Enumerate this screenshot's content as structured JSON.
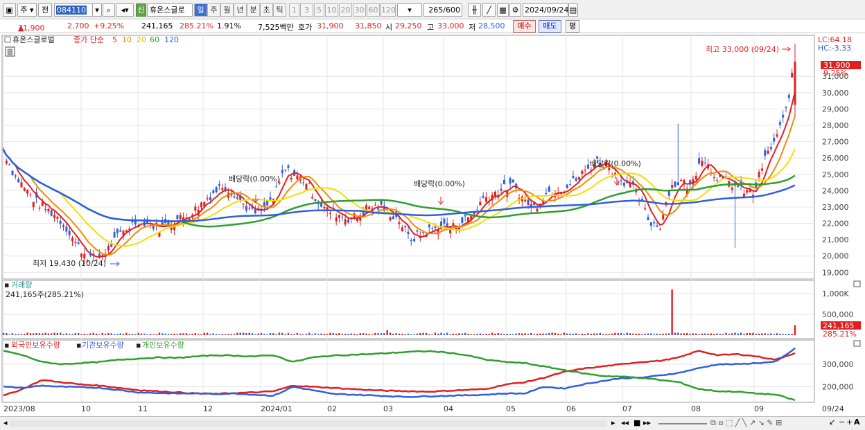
{
  "toolbar": {
    "type_label": "주",
    "prev_label": "전",
    "code": "084110",
    "new_badge": "신",
    "stock_name": "휴온스글로",
    "periods": [
      "일",
      "주",
      "월",
      "년",
      "분",
      "초",
      "틱"
    ],
    "active_period": "일",
    "intervals": [
      "1",
      "3",
      "5",
      "10",
      "20",
      "30",
      "60",
      "120"
    ],
    "count_display": "265",
    "count_max": "/600",
    "date": "2024/09/24"
  },
  "quote": {
    "price": "31,900",
    "change": "2,700",
    "change_pct": "+9.25%",
    "volume": "241,165",
    "vol_ratio": "285.21%",
    "turnover_pct": "1.91%",
    "amount": "7,525백만",
    "quote_label": "호가",
    "ask": "31,900",
    "bid": "31,850",
    "open_label": "시",
    "open": "29,250",
    "high_label": "고",
    "high": "33,000",
    "low_label": "저",
    "low": "28,500",
    "buy_label": "매수",
    "sell_label": "매도",
    "eval_label": "평"
  },
  "price_panel": {
    "legend_name": "휴온스글로벌",
    "legend_close": "종가 단순",
    "ma_labels": [
      "5",
      "10",
      "20",
      "60",
      "120"
    ],
    "ma_colors": [
      "#e02020",
      "#f08c00",
      "#f0e000",
      "#2e9e2e",
      "#2f5fe0"
    ],
    "lc": "LC:64.18",
    "hc": "HC:-3.33",
    "high_note": "최고 33,000 (09/24)",
    "low_note": "최저 19,430 (10/24)",
    "dividend_label": "배당락(0.00%)",
    "current_tag": "31,900",
    "current_pct": "9.25%",
    "y_ticks": [
      "31,000",
      "30,000",
      "29,000",
      "28,000",
      "27,000",
      "26,000",
      "25,000",
      "24,000",
      "23,000",
      "22,000",
      "21,000",
      "20,000",
      "19,000"
    ]
  },
  "volume_panel": {
    "title": "거래량",
    "value": "241,165주(285.21%)",
    "y_ticks": [
      "1,000K",
      "500,000"
    ],
    "current_tag": "241,165",
    "current_pct": "285.21%"
  },
  "holdings_panel": {
    "legend": [
      "외국인보유수량",
      "기관보유수량",
      "개인보유수량"
    ],
    "colors": [
      "#e02020",
      "#2f5fe0",
      "#2e9e2e"
    ],
    "y_ticks": [
      "300,000",
      "200,000"
    ]
  },
  "x_axis": {
    "labels": [
      "2023/08",
      "10",
      "11",
      "12",
      "2024/01",
      "02",
      "03",
      "04",
      "05",
      "06",
      "07",
      "08",
      "09"
    ],
    "right_label": "09/24"
  },
  "chart_data": {
    "type": "line",
    "title": "휴온스글로벌",
    "series": [
      {
        "name": "종가",
        "values": [
          26500,
          25000,
          24200,
          23400,
          22900,
          22500,
          21800,
          20700,
          20000,
          19800,
          20400,
          21200,
          21800,
          22200,
          22000,
          21700,
          22100,
          22300,
          22600,
          23200,
          23800,
          24300,
          24000,
          23200,
          22600,
          22800,
          23600,
          25300,
          24900,
          24600,
          23500,
          22800,
          22600,
          22300,
          22400,
          23000,
          23000,
          22700,
          22200,
          21000,
          21300,
          21600,
          21900,
          21700,
          22100,
          22500,
          23500,
          23800,
          24100,
          24300,
          23400,
          23000,
          23800,
          24100,
          24200,
          24700,
          25300,
          25800,
          25600,
          24700,
          24500,
          23600,
          22100,
          21800,
          24200,
          24600,
          24200,
          26200,
          25200,
          24600,
          24400,
          24000,
          23800,
          25800,
          27000,
          28500,
          31900
        ]
      },
      {
        "name": "외국인보유수량",
        "values": [
          160000,
          190000,
          230000,
          220000,
          210000,
          205000,
          195000,
          185000,
          180000,
          175000,
          170000,
          168000,
          172000,
          175000,
          180000,
          205000,
          200000,
          195000,
          190000,
          185000,
          182000,
          180000,
          178000,
          182000,
          186000,
          190000,
          210000,
          220000,
          240000,
          265000,
          280000,
          290000,
          300000,
          310000,
          315000,
          330000,
          360000,
          340000,
          345000,
          335000,
          320000,
          350000
        ]
      },
      {
        "name": "기관보유수량",
        "values": [
          200000,
          195000,
          205000,
          200000,
          198000,
          195000,
          185000,
          175000,
          172000,
          170000,
          170000,
          168000,
          170000,
          165000,
          160000,
          200000,
          185000,
          168000,
          165000,
          162000,
          158000,
          155000,
          158000,
          160000,
          162000,
          165000,
          170000,
          170000,
          200000,
          192000,
          210000,
          225000,
          238000,
          240000,
          250000,
          262000,
          282000,
          300000,
          300000,
          305000,
          310000,
          370000
        ]
      },
      {
        "name": "개인보유수량",
        "values": [
          360000,
          340000,
          310000,
          300000,
          305000,
          310000,
          320000,
          325000,
          330000,
          328000,
          335000,
          340000,
          338000,
          335000,
          340000,
          310000,
          330000,
          338000,
          342000,
          345000,
          350000,
          355000,
          358000,
          352000,
          340000,
          320000,
          310000,
          305000,
          290000,
          275000,
          260000,
          248000,
          245000,
          240000,
          230000,
          220000,
          190000,
          180000,
          178000,
          170000,
          165000,
          140000
        ]
      }
    ],
    "ylim_price": [
      18800,
      33300
    ],
    "ylim_volume": [
      0,
      1200000
    ],
    "ylim_holdings": [
      140000,
      380000
    ]
  }
}
